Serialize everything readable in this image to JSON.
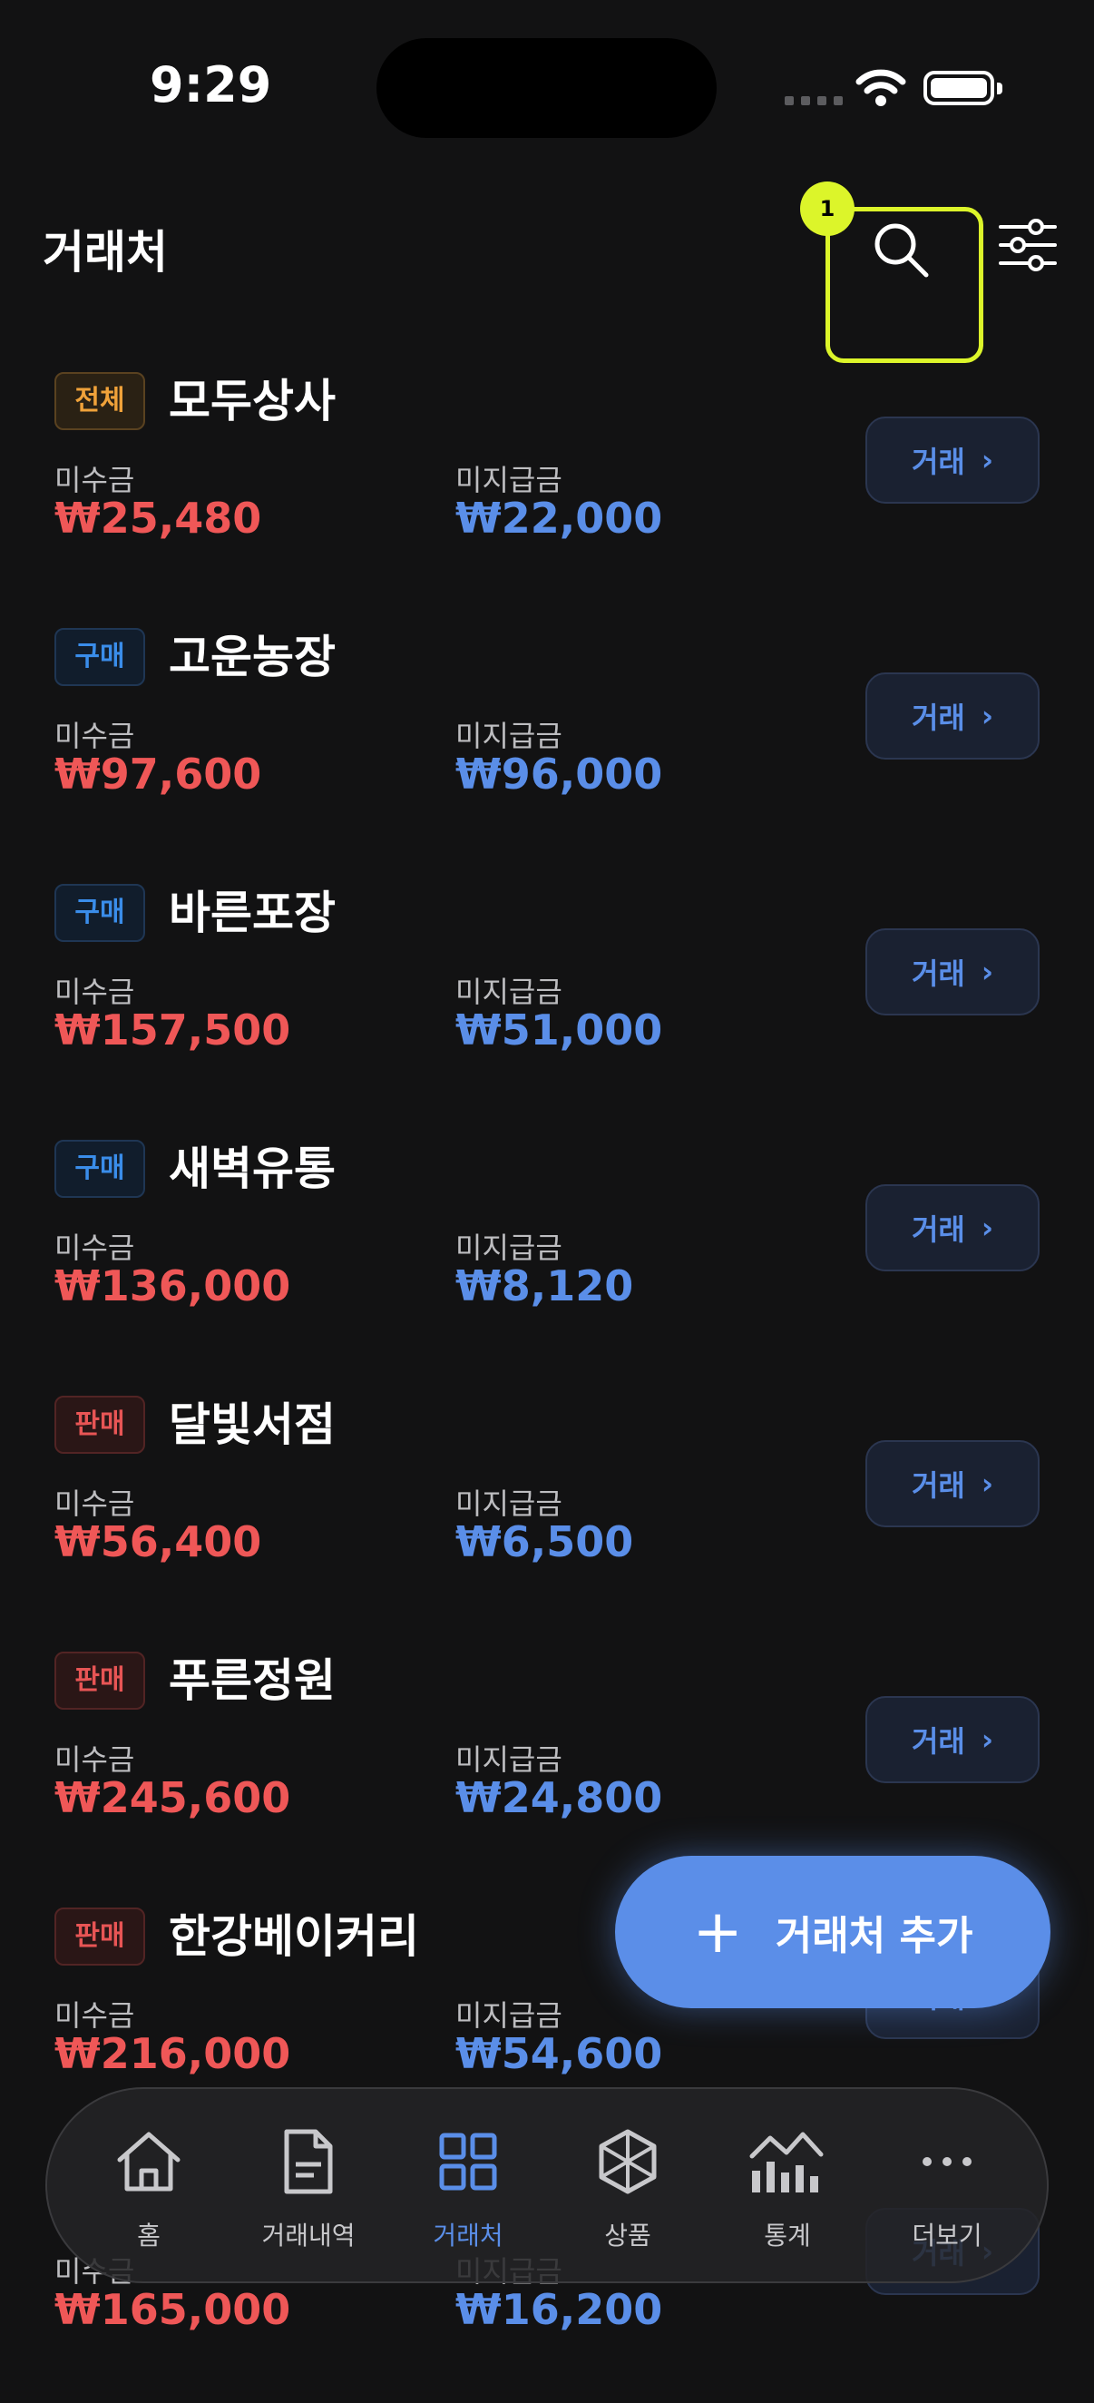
{
  "status": {
    "time": "9:29"
  },
  "header": {
    "title": "거래처",
    "step_badge": "1"
  },
  "labels": {
    "receivable": "미수금",
    "payable": "미지급금",
    "trade_button": "거래"
  },
  "vendors": [
    {
      "tag": "전체",
      "tag_type": "all",
      "name": "모두상사",
      "receivable": "₩25,480",
      "payable": "₩22,000"
    },
    {
      "tag": "구매",
      "tag_type": "buy",
      "name": "고운농장",
      "receivable": "₩97,600",
      "payable": "₩96,000"
    },
    {
      "tag": "구매",
      "tag_type": "buy",
      "name": "바른포장",
      "receivable": "₩157,500",
      "payable": "₩51,000"
    },
    {
      "tag": "구매",
      "tag_type": "buy",
      "name": "새벽유통",
      "receivable": "₩136,000",
      "payable": "₩8,120"
    },
    {
      "tag": "판매",
      "tag_type": "sell",
      "name": "달빛서점",
      "receivable": "₩56,400",
      "payable": "₩6,500"
    },
    {
      "tag": "판매",
      "tag_type": "sell",
      "name": "푸른정원",
      "receivable": "₩245,600",
      "payable": "₩24,800"
    },
    {
      "tag": "판매",
      "tag_type": "sell",
      "name": "한강베이커리",
      "receivable": "₩216,000",
      "payable": "₩54,600"
    },
    {
      "tag": "",
      "tag_type": "sell",
      "name": "",
      "receivable": "₩165,000",
      "payable": "₩16,200"
    }
  ],
  "fab": {
    "label": "거래처 추가"
  },
  "tabs": [
    {
      "label": "홈",
      "icon": "home-icon"
    },
    {
      "label": "거래내역",
      "icon": "document-icon"
    },
    {
      "label": "거래처",
      "icon": "grid-icon",
      "active": true
    },
    {
      "label": "상품",
      "icon": "cube-icon"
    },
    {
      "label": "통계",
      "icon": "chart-icon"
    },
    {
      "label": "더보기",
      "icon": "more-icon"
    }
  ],
  "colors": {
    "accent": "#5a8ee8",
    "receivable": "#ef5757",
    "highlight": "#dcf52a",
    "background": "#121213"
  }
}
